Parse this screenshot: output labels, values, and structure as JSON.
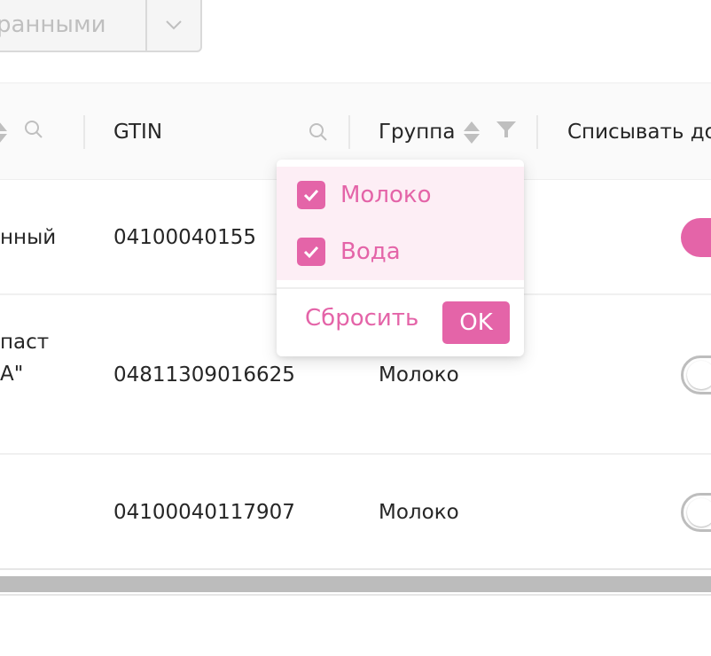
{
  "toolbar": {
    "action_label": "ранными",
    "caret_icon": "chevron-down-icon"
  },
  "table": {
    "columns": {
      "gtin": "GTIN",
      "group": "Группа",
      "writeoff": "Списывать до"
    },
    "rows": [
      {
        "name": "нный",
        "gtin": "04100040155",
        "group": "",
        "toggle": "on"
      },
      {
        "name_line1": "паст",
        "name_line2": "A\"",
        "gtin": "04811309016625",
        "group": "Молоко",
        "toggle": "off"
      },
      {
        "name": "",
        "gtin": "04100040117907",
        "group": "Молоко",
        "toggle": "off"
      }
    ]
  },
  "filter_popup": {
    "options": [
      {
        "label": "Молоко",
        "checked": true
      },
      {
        "label": "Вода",
        "checked": true
      }
    ],
    "reset_label": "Сбросить",
    "ok_label": "OK"
  },
  "colors": {
    "accent": "#e464a8",
    "accent_light": "#fdeef5",
    "header_bg": "#fafafa",
    "disabled_text": "#bfbfbf"
  }
}
